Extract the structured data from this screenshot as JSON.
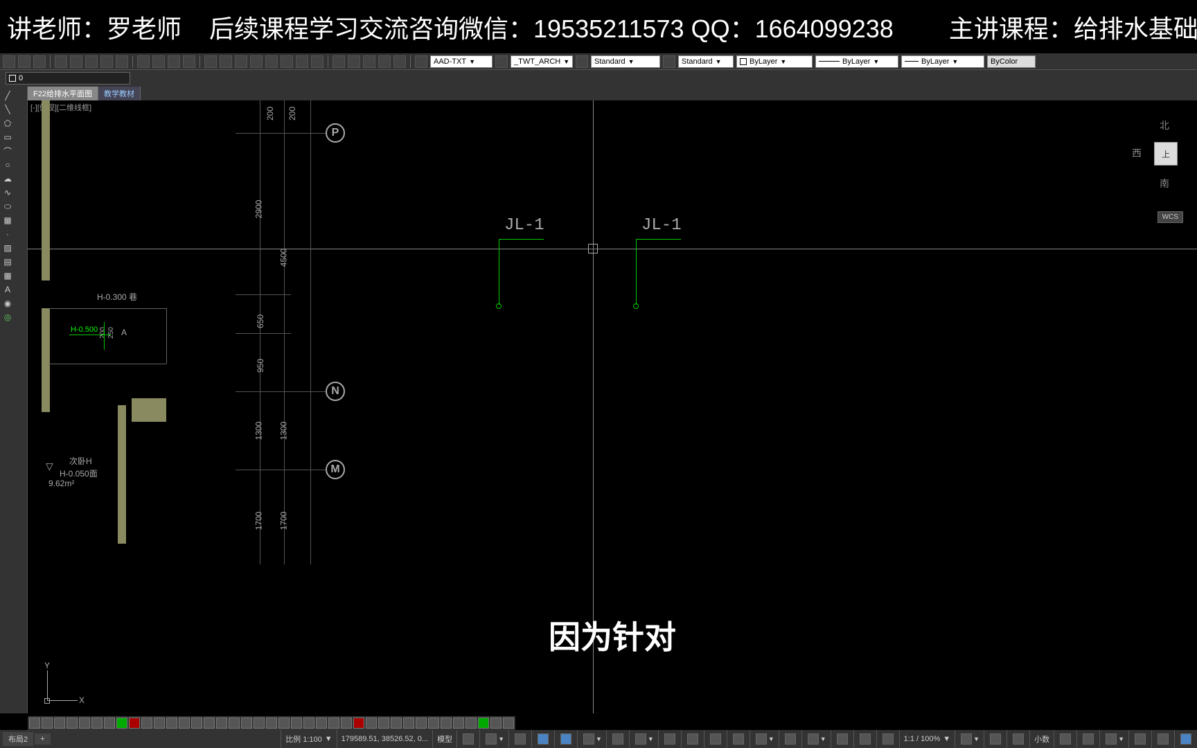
{
  "banner": {
    "teacher": "讲老师：罗老师",
    "contact": "后续课程学习交流咨询微信：19535211573  QQ：1664099238",
    "course": "主讲课程：给排水基础画"
  },
  "toolbar": {
    "textstyle": "AAD-TXT",
    "dimstyle": "_TWT_ARCH",
    "tablestyle": "Standard",
    "mlstyle": "Standard",
    "color": "ByLayer",
    "linetype": "ByLayer",
    "lineweight": "ByLayer",
    "plotstyle": "ByColor"
  },
  "layer": {
    "current": "0"
  },
  "tabs": {
    "tab1": "F22给排水平面图",
    "tab2": "教学教材"
  },
  "viewport": {
    "corner_label": "[-][俯视][二维线框]"
  },
  "viewcube": {
    "top": "上",
    "n": "北",
    "w": "西",
    "s": "南",
    "wcs": "WCS"
  },
  "grid": {
    "p": "P",
    "n": "N",
    "m": "M"
  },
  "dims": {
    "d200a": "200",
    "d200b": "200",
    "d2900": "2900",
    "d4500": "4500",
    "d650": "650",
    "d950": "950",
    "d1300a": "1300",
    "d1300b": "1300",
    "d1700a": "1700",
    "d1700b": "1700",
    "d200c": "200",
    "d250": "250",
    "h030": "H-0.300 巷",
    "h050_label": "H-0.500",
    "a_label": "A",
    "room_name": "次卧H",
    "room_h": "H-0.050面",
    "room_area": "9.62m²"
  },
  "jl": {
    "label1": "JL-1",
    "label2": "JL-1"
  },
  "ucs": {
    "x": "X",
    "y": "Y"
  },
  "subtitle": "因为针对",
  "status": {
    "layout1": "布局2",
    "plus": "+",
    "scale_label": "比例 1:100",
    "coords": "179589.51, 38526.52, 0...",
    "model": "模型",
    "annoscale": "1:1 / 100%",
    "precision": "小数"
  }
}
